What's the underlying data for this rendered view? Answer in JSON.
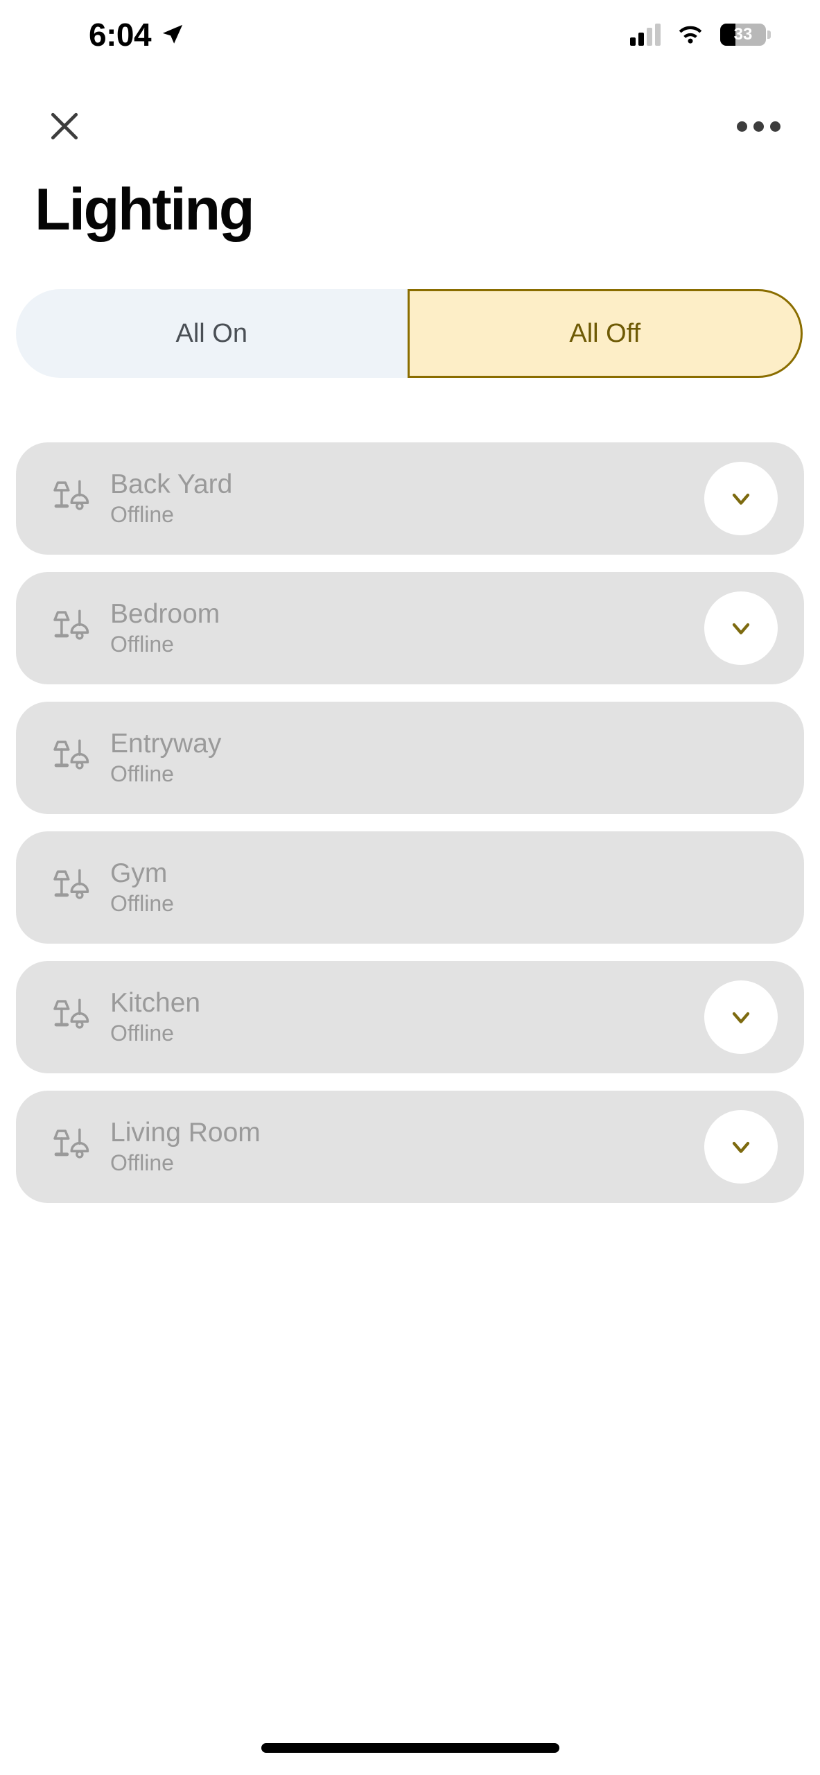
{
  "status_bar": {
    "time": "6:04",
    "location_icon": "location-arrow-icon",
    "cellular_icon": "cellular-signal-icon",
    "wifi_icon": "wifi-icon",
    "battery_icon": "battery-icon",
    "battery_percent": "33"
  },
  "nav": {
    "close_icon": "close-icon",
    "more_icon": "more-options-icon"
  },
  "header": {
    "title": "Lighting"
  },
  "segmented_control": {
    "selected": "All Off",
    "options": [
      {
        "label": "All On",
        "selected": false
      },
      {
        "label": "All Off",
        "selected": true
      }
    ],
    "on_bg": "#eef3f8",
    "on_text": "#4a4f55",
    "off_bg": "#fdeec7",
    "off_border": "#8a6d00",
    "off_text": "#6e5a05"
  },
  "devices": {
    "row_bg": "#e2e2e2",
    "text_color": "#9a9a9a",
    "chevron_color": "#7d6a0f",
    "icon_name": "lamp-icon",
    "items": [
      {
        "name": "Back Yard",
        "status": "Offline",
        "has_expand": true
      },
      {
        "name": "Bedroom",
        "status": "Offline",
        "has_expand": true
      },
      {
        "name": "Entryway",
        "status": "Offline",
        "has_expand": false
      },
      {
        "name": "Gym",
        "status": "Offline",
        "has_expand": false
      },
      {
        "name": "Kitchen",
        "status": "Offline",
        "has_expand": true
      },
      {
        "name": "Living Room",
        "status": "Offline",
        "has_expand": true
      }
    ]
  },
  "home_indicator": "home-indicator"
}
